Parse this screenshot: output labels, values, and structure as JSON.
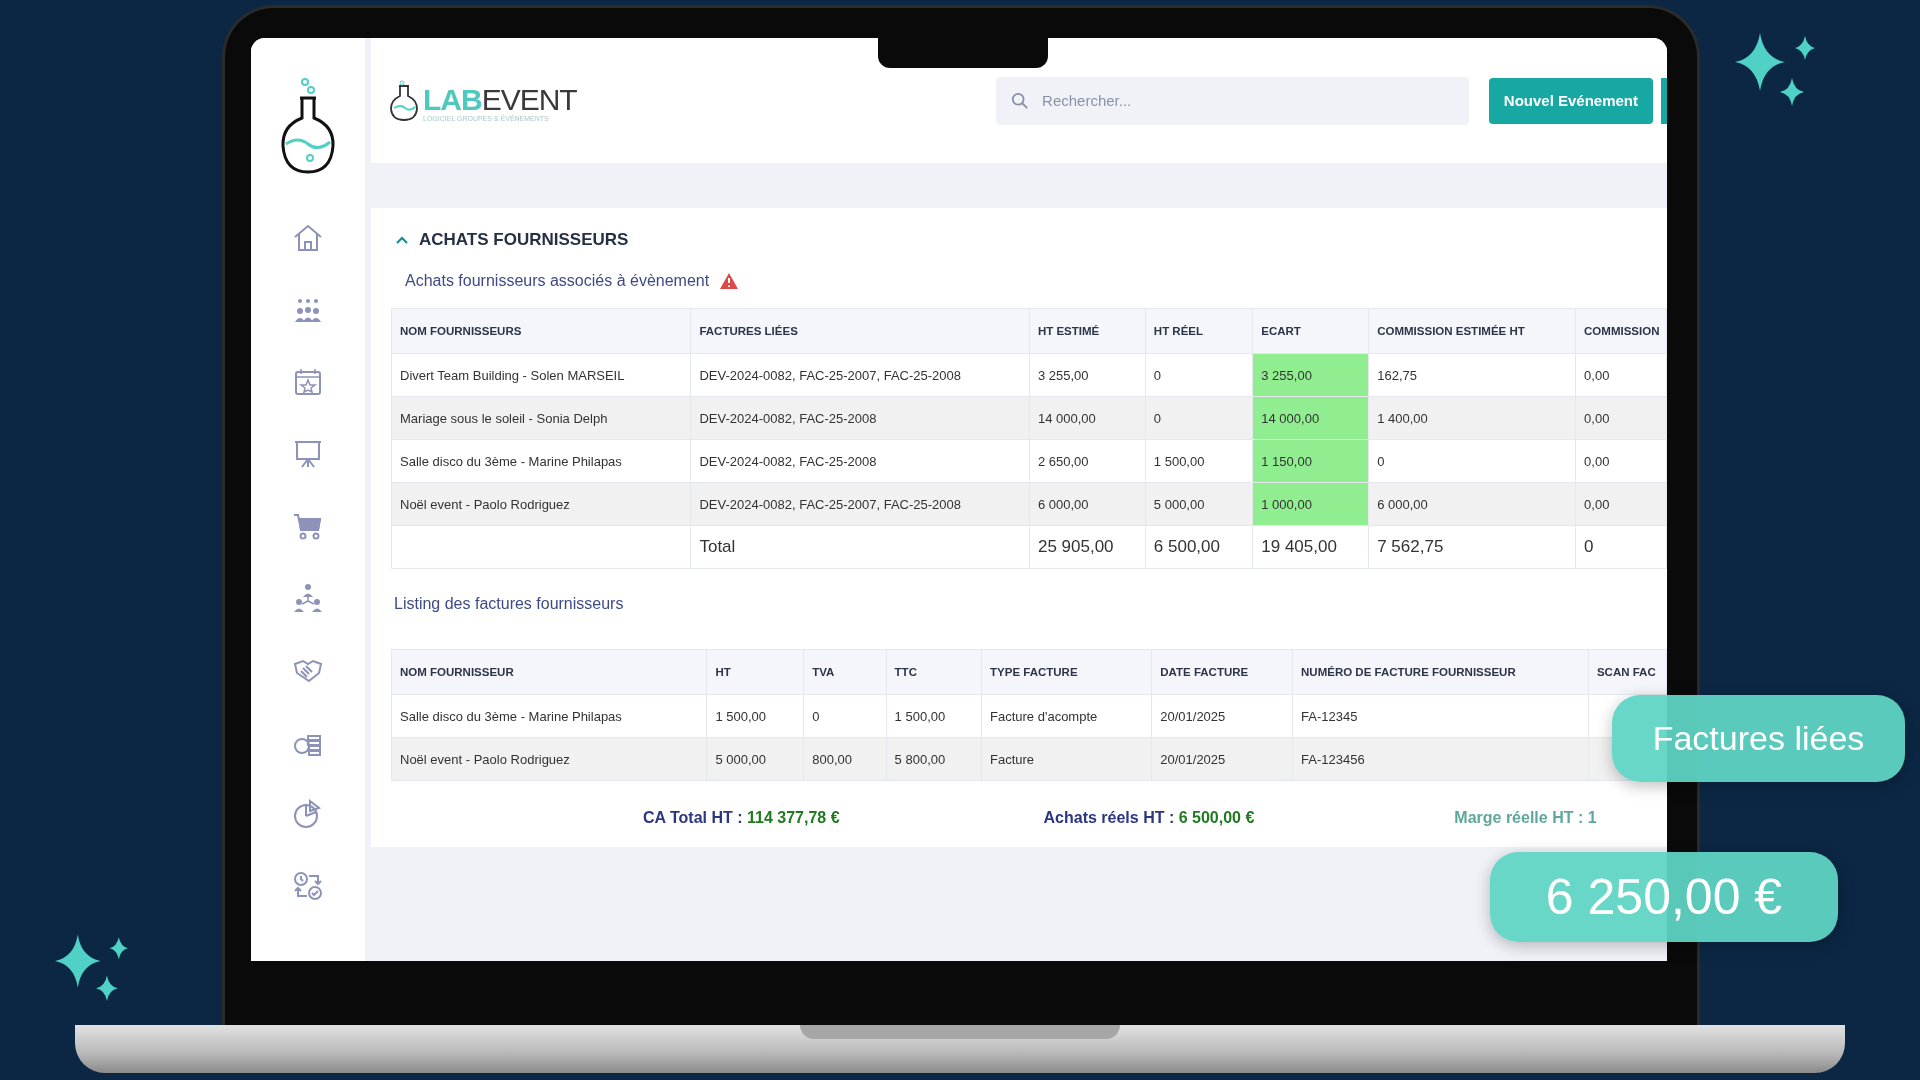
{
  "header": {
    "logo": {
      "brand_part_1": "LAB",
      "brand_part_2": "EVENT",
      "tagline": "LOGICIEL GROUPES & ÉVÉNEMENTS"
    },
    "search": {
      "placeholder": "Rechercher..."
    },
    "primary_button": "Nouvel Evénement"
  },
  "sidebar": {
    "items": [
      {
        "kind": "home"
      },
      {
        "kind": "group"
      },
      {
        "kind": "calendar"
      },
      {
        "kind": "presentation"
      },
      {
        "kind": "cart"
      },
      {
        "kind": "hierarchy"
      },
      {
        "kind": "handshake"
      },
      {
        "kind": "coins"
      },
      {
        "kind": "pie"
      },
      {
        "kind": "process"
      }
    ]
  },
  "section": {
    "title": "ACHATS FOURNISSEURS",
    "expanded": true,
    "subtitle": "Achats fournisseurs associés à évènement",
    "warning": true,
    "purchases_table": {
      "columns": [
        "NOM FOURNISSEURS",
        "FACTURES LIÉES",
        "HT ESTIMÉ",
        "HT RÉEL",
        "ECART",
        "COMMISSION ESTIMÉE HT",
        "COMMISSION"
      ],
      "rows": [
        {
          "cells": [
            "Divert Team Building - Solen MARSEIL",
            "DEV-2024-0082, FAC-25-2007, FAC-25-2008",
            "3 255,00",
            "0",
            "3 255,00",
            "162,75",
            "0,00"
          ],
          "ecart_highlight": true
        },
        {
          "cells": [
            "Mariage sous le soleil - Sonia Delph",
            "DEV-2024-0082, FAC-25-2008",
            "14 000,00",
            "0",
            "14 000,00",
            "1 400,00",
            "0,00"
          ],
          "ecart_highlight": true
        },
        {
          "cells": [
            "Salle disco du 3ème - Marine Philapas",
            "DEV-2024-0082, FAC-25-2008",
            "2 650,00",
            "1 500,00",
            "1 150,00",
            "0",
            "0,00"
          ],
          "ecart_highlight": true
        },
        {
          "cells": [
            "Noël event - Paolo Rodriguez",
            "DEV-2024-0082, FAC-25-2007, FAC-25-2008",
            "6 000,00",
            "5 000,00",
            "1 000,00",
            "6 000,00",
            "0,00"
          ],
          "ecart_highlight": true
        }
      ],
      "total": {
        "label": "Total",
        "values": [
          "25 905,00",
          "6 500,00",
          "19 405,00",
          "7 562,75",
          "0"
        ]
      }
    },
    "invoices_title": "Listing des factures fournisseurs",
    "invoices_table": {
      "columns": [
        "NOM FOURNISSEUR",
        "HT",
        "TVA",
        "TTC",
        "TYPE FACTURE",
        "DATE FACTURE",
        "NUMÉRO DE FACTURE FOURNISSEUR",
        "SCAN FAC"
      ],
      "rows": [
        {
          "cells": [
            "Salle disco du 3ème - Marine Philapas",
            "1 500,00",
            "0",
            "1 500,00",
            "Facture d'acompte",
            "20/01/2025",
            "FA-12345"
          ]
        },
        {
          "cells": [
            "Noël event - Paolo Rodriguez",
            "5 000,00",
            "800,00",
            "5 800,00",
            "Facture",
            "20/01/2025",
            "FA-123456"
          ]
        }
      ]
    },
    "totals": [
      {
        "label": "CA Total HT : ",
        "value": "114 377,78 €"
      },
      {
        "label": "Achats réels HT : ",
        "value": "6 500,00 €"
      },
      {
        "label": "Marge réelle HT : 1"
      }
    ]
  },
  "callouts": [
    {
      "text": "Factures liées"
    },
    {
      "text": "6 250,00 €"
    }
  ]
}
